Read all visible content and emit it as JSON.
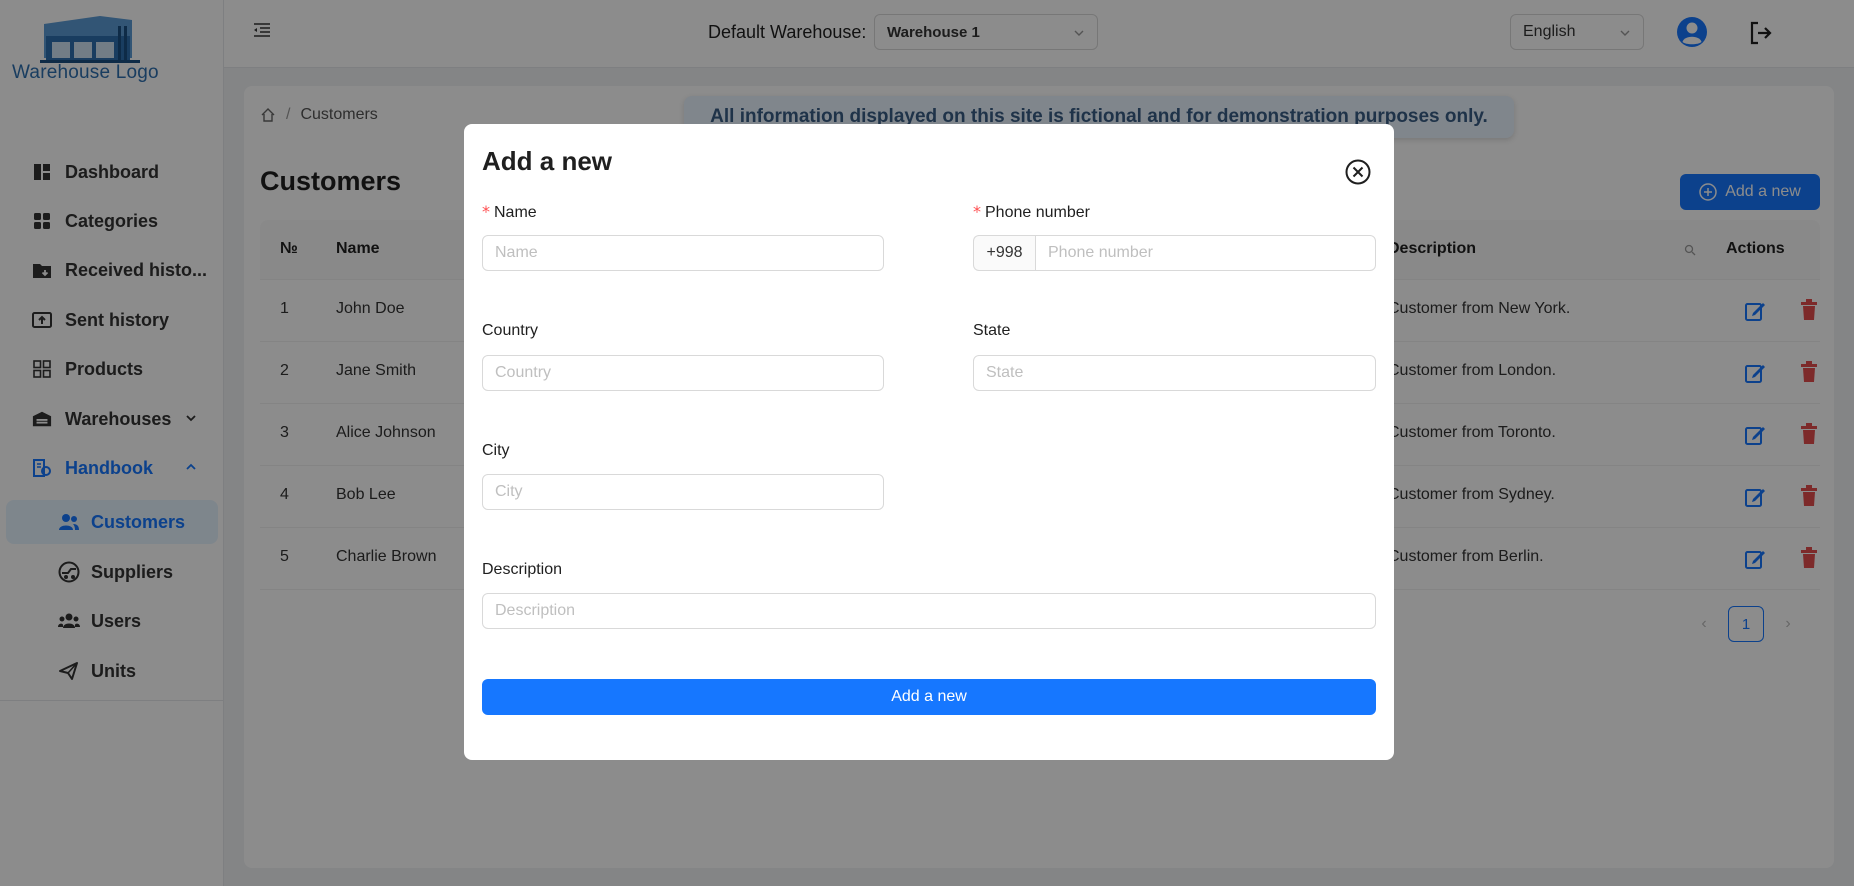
{
  "colors": {
    "primary": "#1677ff",
    "danger": "#e34d4d",
    "logo": "#2e6fb0"
  },
  "logo": {
    "text": "Warehouse Logo"
  },
  "sidebar": {
    "items": [
      {
        "label": "Dashboard",
        "icon": "dashboard-icon"
      },
      {
        "label": "Categories",
        "icon": "categories-icon"
      },
      {
        "label": "Received histo...",
        "icon": "folder-download-icon"
      },
      {
        "label": "Sent history",
        "icon": "upload-box-icon"
      },
      {
        "label": "Products",
        "icon": "products-grid-icon"
      },
      {
        "label": "Warehouses",
        "icon": "warehouse-icon",
        "expanded": false
      },
      {
        "label": "Handbook",
        "icon": "handbook-icon",
        "expanded": true
      }
    ],
    "sub_items": [
      {
        "label": "Customers",
        "icon": "customers-icon",
        "active": true
      },
      {
        "label": "Suppliers",
        "icon": "suppliers-icon"
      },
      {
        "label": "Users",
        "icon": "users-icon"
      },
      {
        "label": "Units",
        "icon": "units-icon"
      }
    ]
  },
  "header": {
    "warehouse_label": "Default Warehouse:",
    "warehouse_value": "Warehouse 1",
    "language_value": "English"
  },
  "breadcrumb": {
    "current": "Customers"
  },
  "notice": "All information displayed on this site is fictional and for demonstration purposes only.",
  "page": {
    "title": "Customers",
    "add_label": "Add a new"
  },
  "table": {
    "headers": {
      "no": "№",
      "name": "Name",
      "description": "Description",
      "actions": "Actions"
    },
    "rows": [
      {
        "no": "1",
        "name": "John Doe",
        "description": "Customer from New York."
      },
      {
        "no": "2",
        "name": "Jane Smith",
        "description": "Customer from London."
      },
      {
        "no": "3",
        "name": "Alice Johnson",
        "description": "Customer from Toronto."
      },
      {
        "no": "4",
        "name": "Bob Lee",
        "description": "Customer from Sydney."
      },
      {
        "no": "5",
        "name": "Charlie Brown",
        "description": "Customer from Berlin."
      }
    ]
  },
  "pagination": {
    "current": "1"
  },
  "modal": {
    "title": "Add a new",
    "fields": {
      "name": {
        "label": "Name",
        "placeholder": "Name",
        "required": true
      },
      "phone": {
        "label": "Phone number",
        "placeholder": "Phone number",
        "prefix": "+998",
        "required": true
      },
      "country": {
        "label": "Country",
        "placeholder": "Country"
      },
      "state": {
        "label": "State",
        "placeholder": "State"
      },
      "city": {
        "label": "City",
        "placeholder": "City"
      },
      "description": {
        "label": "Description",
        "placeholder": "Description"
      }
    },
    "submit_label": "Add a new"
  }
}
